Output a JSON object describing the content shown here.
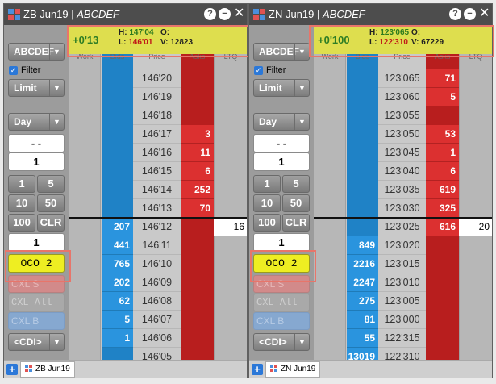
{
  "panels": [
    {
      "instrument": "ZB Jun19",
      "account": "ABCDEF",
      "quote": {
        "change": "+0'13",
        "high_label": "H:",
        "high": "147'04",
        "low_label": "L:",
        "low": "146'01",
        "open_label": "O:",
        "open": "",
        "volume_label": "V:",
        "volume": "12823"
      },
      "account_select": "ABCDEF",
      "filter_label": "Filter",
      "order_type": "Limit",
      "tif": "Day",
      "work_qty": "- -",
      "qty": "1",
      "qty_buttons": [
        "1",
        "5",
        "10",
        "50",
        "100",
        "CLR"
      ],
      "order_qty": "1",
      "oco_label": "OCO 2",
      "cxl_sell_label": "CXL S",
      "cxl_all_label": "CXL All",
      "cxl_buy_label": "CXL B",
      "cdi_label": "<CDI>",
      "headers": [
        "Work",
        "Bids",
        "Price",
        "Asks",
        "LTQ"
      ],
      "rows": [
        {
          "price": "146'20",
          "bid": "",
          "ask": "",
          "ltq": ""
        },
        {
          "price": "146'19",
          "bid": "",
          "ask": "",
          "ltq": ""
        },
        {
          "price": "146'18",
          "bid": "",
          "ask": "",
          "ltq": ""
        },
        {
          "price": "146'17",
          "bid": "",
          "ask": "3",
          "ltq": ""
        },
        {
          "price": "146'16",
          "bid": "",
          "ask": "11",
          "ltq": ""
        },
        {
          "price": "146'15",
          "bid": "",
          "ask": "6",
          "ltq": ""
        },
        {
          "price": "146'14",
          "bid": "",
          "ask": "252",
          "ltq": ""
        },
        {
          "price": "146'13",
          "bid": "",
          "ask": "70",
          "ltq": ""
        },
        {
          "price": "146'12",
          "bid": "207",
          "ask": "",
          "ltq": "16"
        },
        {
          "price": "146'11",
          "bid": "441",
          "ask": "",
          "ltq": ""
        },
        {
          "price": "146'10",
          "bid": "765",
          "ask": "",
          "ltq": ""
        },
        {
          "price": "146'09",
          "bid": "202",
          "ask": "",
          "ltq": ""
        },
        {
          "price": "146'08",
          "bid": "62",
          "ask": "",
          "ltq": ""
        },
        {
          "price": "146'07",
          "bid": "5",
          "ask": "",
          "ltq": ""
        },
        {
          "price": "146'06",
          "bid": "1",
          "ask": "",
          "ltq": ""
        },
        {
          "price": "146'05",
          "bid": "",
          "ask": "",
          "ltq": ""
        }
      ],
      "tab_label": "ZB Jun19"
    },
    {
      "instrument": "ZN Jun19",
      "account": "ABCDEF",
      "quote": {
        "change": "+0'100",
        "high_label": "H:",
        "high": "123'065",
        "low_label": "L:",
        "low": "122'310",
        "open_label": "O:",
        "open": "",
        "volume_label": "V:",
        "volume": "67229"
      },
      "account_select": "ABCDEF",
      "filter_label": "Filter",
      "order_type": "Limit",
      "tif": "Day",
      "work_qty": "- -",
      "qty": "1",
      "qty_buttons": [
        "1",
        "5",
        "10",
        "50",
        "100",
        "CLR"
      ],
      "order_qty": "1",
      "oco_label": "OCO 2",
      "cxl_sell_label": "CXL S",
      "cxl_all_label": "CXL All",
      "cxl_buy_label": "CXL B",
      "cdi_label": "<CDI>",
      "headers": [
        "Work",
        "Bids",
        "Price",
        "Asks",
        "LTQ"
      ],
      "rows": [
        {
          "price": "123'065",
          "bid": "",
          "ask": "71",
          "ltq": ""
        },
        {
          "price": "123'060",
          "bid": "",
          "ask": "5",
          "ltq": ""
        },
        {
          "price": "123'055",
          "bid": "",
          "ask": "",
          "ltq": ""
        },
        {
          "price": "123'050",
          "bid": "",
          "ask": "53",
          "ltq": ""
        },
        {
          "price": "123'045",
          "bid": "",
          "ask": "1",
          "ltq": ""
        },
        {
          "price": "123'040",
          "bid": "",
          "ask": "6",
          "ltq": ""
        },
        {
          "price": "123'035",
          "bid": "",
          "ask": "619",
          "ltq": ""
        },
        {
          "price": "123'030",
          "bid": "",
          "ask": "325",
          "ltq": ""
        },
        {
          "price": "123'025",
          "bid": "",
          "ask": "616",
          "ltq": "20"
        },
        {
          "price": "123'020",
          "bid": "849",
          "ask": "",
          "ltq": ""
        },
        {
          "price": "123'015",
          "bid": "2216",
          "ask": "",
          "ltq": ""
        },
        {
          "price": "123'010",
          "bid": "2247",
          "ask": "",
          "ltq": ""
        },
        {
          "price": "123'005",
          "bid": "275",
          "ask": "",
          "ltq": ""
        },
        {
          "price": "123'000",
          "bid": "81",
          "ask": "",
          "ltq": ""
        },
        {
          "price": "122'315",
          "bid": "55",
          "ask": "",
          "ltq": ""
        },
        {
          "price": "122'310",
          "bid": "13019",
          "ask": "",
          "ltq": ""
        }
      ],
      "tab_label": "ZN Jun19"
    }
  ],
  "window_controls": {
    "help": "?",
    "minimize": "−",
    "close": "✕"
  },
  "tab_add": "+",
  "colors": {
    "bid": "#2a94de",
    "ask": "#dc3030",
    "quote_bar": "#dede4e",
    "oco": "#eeee22",
    "title_bar": "#4d4d4d",
    "highlight": "#e8756a"
  },
  "icons": {
    "title": "flag-icon",
    "filter": "checkbox-icon"
  }
}
